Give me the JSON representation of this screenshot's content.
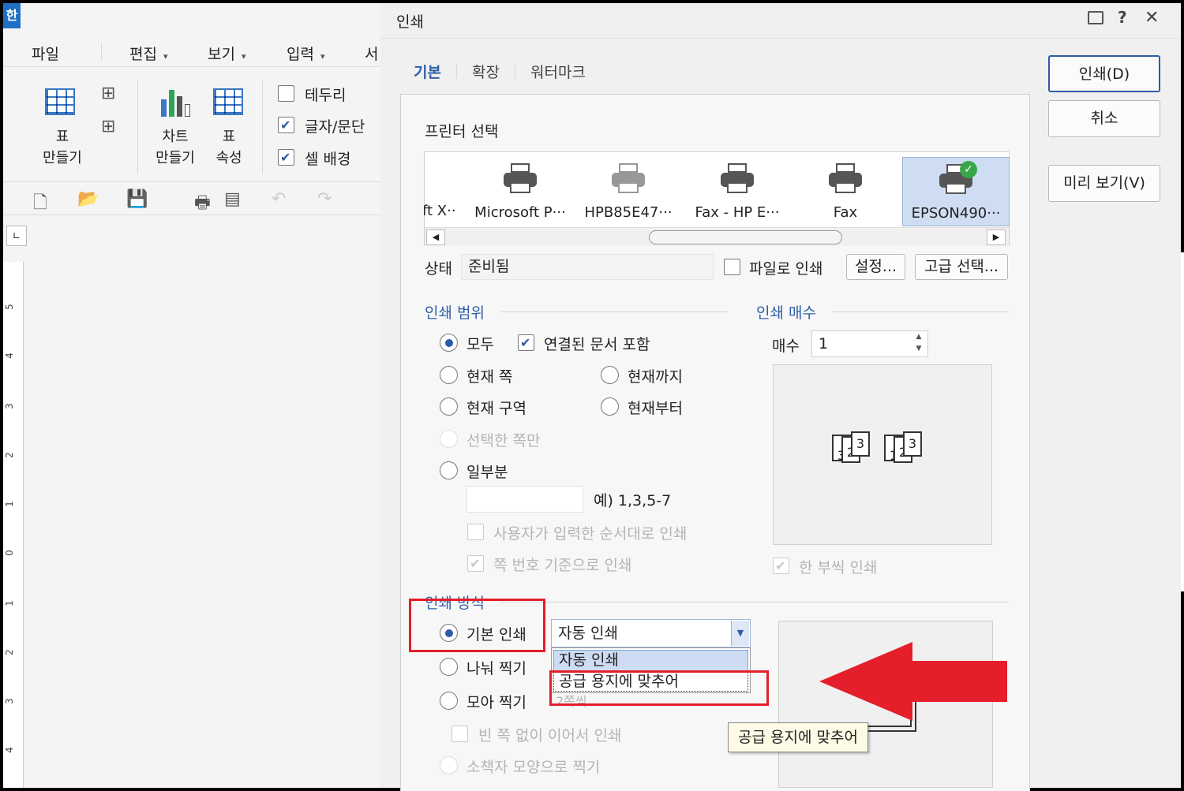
{
  "app": {
    "logo": "한",
    "menu": [
      "파일",
      "편집",
      "보기",
      "입력",
      "서"
    ],
    "ribbon": {
      "table_label": "표\n만들기",
      "chart_label": "차트\n만들기",
      "table_prop_label": "표\n속성",
      "checkboxes": [
        {
          "label": "테두리",
          "checked": false
        },
        {
          "label": "글자/문단",
          "checked": true
        },
        {
          "label": "셀 배경",
          "checked": true
        }
      ]
    },
    "ruler_numbers": [
      "5",
      "4",
      "3",
      "2",
      "1",
      "0",
      "1",
      "2",
      "3",
      "4"
    ]
  },
  "dialog": {
    "title": "인쇄",
    "title_icons": [
      "feedback-icon",
      "help-icon",
      "close-icon"
    ],
    "tabs": [
      "기본",
      "확장",
      "워터마크"
    ],
    "buttons": {
      "print": "인쇄(D)",
      "cancel": "취소",
      "preview": "미리 보기(V)"
    },
    "printer_section": {
      "label": "프린터 선택",
      "printers": [
        {
          "name": "ft X···"
        },
        {
          "name": "Microsoft P···"
        },
        {
          "name": "HPB85E47···"
        },
        {
          "name": "Fax - HP E···"
        },
        {
          "name": "Fax"
        },
        {
          "name": "EPSON490···",
          "selected": true
        }
      ],
      "status_label": "상태",
      "status_value": "준비됨",
      "print_to_file": "파일로 인쇄",
      "settings": "설정...",
      "advanced": "고급 선택..."
    },
    "range": {
      "label": "인쇄 범위",
      "all": "모두",
      "include_linked": "연결된 문서 포함",
      "current_page": "현재 쪽",
      "to_current": "현재까지",
      "current_section": "현재 구역",
      "from_current": "현재부터",
      "selected_only": "선택한 쪽만",
      "partial": "일부분",
      "partial_hint": "예) 1,3,5-7",
      "user_order": "사용자가 입력한 순서대로 인쇄",
      "page_number_based": "쪽 번호 기준으로 인쇄"
    },
    "copies": {
      "label": "인쇄 매수",
      "count_label": "매수",
      "count": "1",
      "collate": "한 부씩 인쇄",
      "collate_pages": [
        "1",
        "2",
        "3"
      ]
    },
    "method": {
      "label": "인쇄 방식",
      "basic": "기본 인쇄",
      "split": "나눠 찍기",
      "gather": "모아 찍기",
      "continuous": "빈 쪽 없이 이어서 인쇄",
      "booklet": "소책자 모양으로 찍기",
      "dropdown_value": "자동 인쇄",
      "dropdown_options": [
        "자동 인쇄",
        "공급 용지에 맞추어"
      ],
      "gather_value": "2쪽씩",
      "tooltip": "공급 용지에 맞추어"
    }
  },
  "colors": {
    "accent": "#2e5aa8",
    "annotation": "#e41e2a",
    "section": "#2e5fa8"
  }
}
